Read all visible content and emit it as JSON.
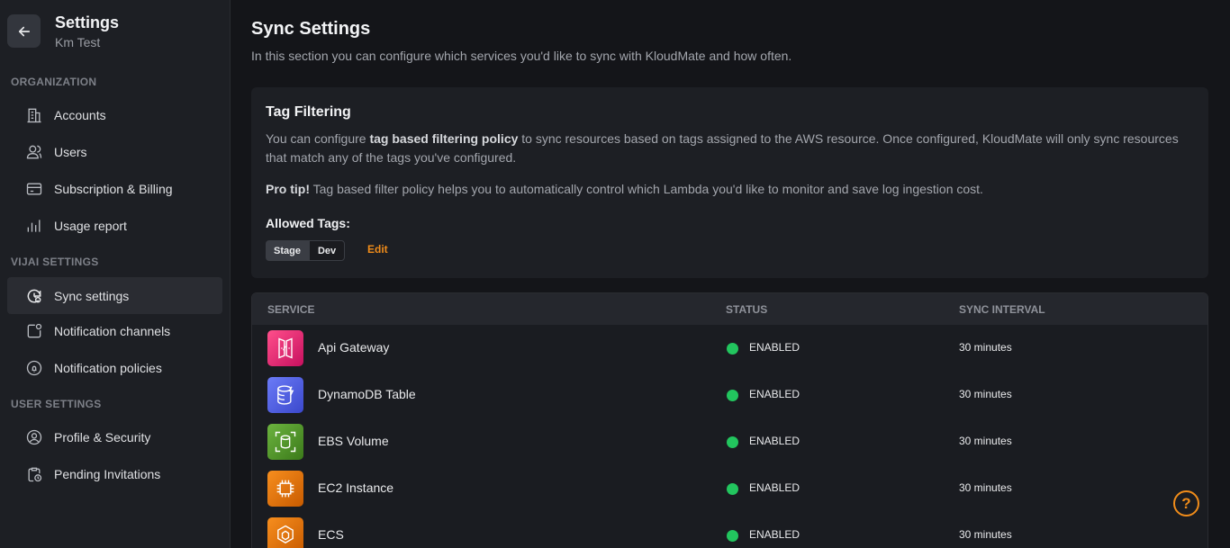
{
  "sidebar": {
    "title": "Settings",
    "subtitle": "Km Test",
    "sections": {
      "organization": "ORGANIZATION",
      "vijai": "VIJAI SETTINGS",
      "user": "USER SETTINGS"
    },
    "items": [
      {
        "label": "Accounts",
        "icon": "building-icon"
      },
      {
        "label": "Users",
        "icon": "users-icon"
      },
      {
        "label": "Subscription & Billing",
        "icon": "credit-card-icon"
      },
      {
        "label": "Usage report",
        "icon": "bar-chart-icon"
      },
      {
        "label": "Sync settings",
        "icon": "sync-settings-icon",
        "active": true
      },
      {
        "label": "Notification channels",
        "icon": "notification-channel-icon"
      },
      {
        "label": "Notification policies",
        "icon": "bell-icon"
      },
      {
        "label": "Profile & Security",
        "icon": "user-circle-icon"
      },
      {
        "label": "Pending Invitations",
        "icon": "clipboard-clock-icon"
      }
    ]
  },
  "main": {
    "title": "Sync Settings",
    "description": "In this section you can configure which services you'd like to sync with KloudMate and how often."
  },
  "tag_filtering": {
    "title": "Tag Filtering",
    "text_pre": "You can configure ",
    "text_bold": "tag based filtering policy",
    "text_post": " to sync resources based on tags assigned to the AWS resource. Once configured, KloudMate will only sync resources that match any of the tags you've configured.",
    "tip_bold": "Pro tip!",
    "tip_text": " Tag based filter policy helps you to automatically control which Lambda you'd like to monitor and save log ingestion cost.",
    "allowed_label": "Allowed Tags:",
    "tags": [
      "Stage",
      "Dev"
    ],
    "edit_label": "Edit"
  },
  "table": {
    "headers": [
      "SERVICE",
      "STATUS",
      "SYNC INTERVAL"
    ],
    "rows": [
      {
        "service": "Api Gateway",
        "status": "ENABLED",
        "interval": "30 minutes",
        "color": "#e7157b"
      },
      {
        "service": "DynamoDB Table",
        "status": "ENABLED",
        "interval": "30 minutes",
        "color": "#4d5bd9"
      },
      {
        "service": "EBS Volume",
        "status": "ENABLED",
        "interval": "30 minutes",
        "color": "#4d9a24"
      },
      {
        "service": "EC2 Instance",
        "status": "ENABLED",
        "interval": "30 minutes",
        "color": "#ed7100"
      },
      {
        "service": "ECS",
        "status": "ENABLED",
        "interval": "30 minutes",
        "color": "#ed7100"
      }
    ]
  },
  "colors": {
    "accent": "#f08c1a",
    "enabled": "#22c55e"
  }
}
